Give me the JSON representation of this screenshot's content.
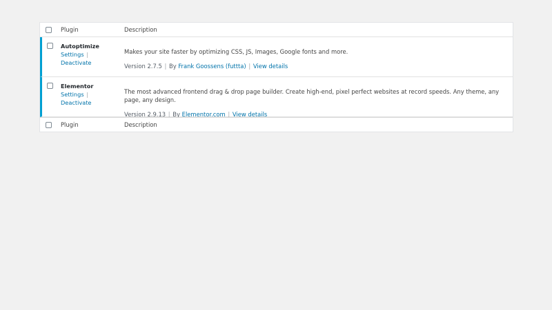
{
  "table": {
    "header": {
      "plugin": "Plugin",
      "description": "Description"
    },
    "footer": {
      "plugin": "Plugin",
      "description": "Description"
    },
    "plugins": [
      {
        "name": "Autoptimize",
        "actions": {
          "settings": "Settings",
          "separator": "|",
          "deactivate": "Deactivate"
        },
        "description": "Makes your site faster by optimizing CSS, JS, Images, Google fonts and more.",
        "version": "Version 2.7.5",
        "by": "By",
        "author": "Frank Goossens (futtta)",
        "view_details": "View details"
      },
      {
        "name": "Elementor",
        "actions": {
          "settings": "Settings",
          "separator": "|",
          "deactivate": "Deactivate"
        },
        "description": "The most advanced frontend drag & drop page builder. Create high-end, pixel perfect websites at record speeds. Any theme, any page, any design.",
        "version": "Version 2.9.13",
        "by": "By",
        "author": "Elementor.com",
        "view_details": "View details"
      }
    ]
  },
  "colors": {
    "link": "#0073aa",
    "active_border": "#00a0d2",
    "background": "#f1f1f1"
  }
}
